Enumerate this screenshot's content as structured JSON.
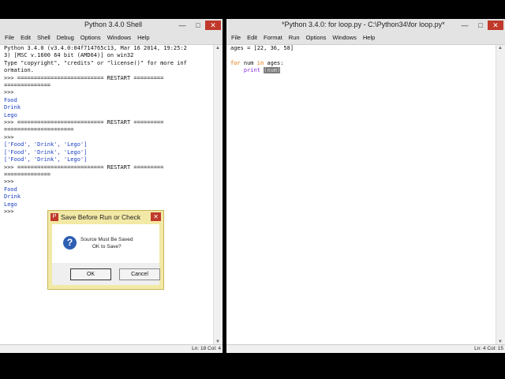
{
  "shell": {
    "title": "Python 3.4.0 Shell",
    "menu": [
      "File",
      "Edit",
      "Shell",
      "Debug",
      "Options",
      "Windows",
      "Help"
    ],
    "lines": [
      "Python 3.4.0 (v3.4.0:04f714765c13, Mar 16 2014, 19:25:2",
      "3) [MSC v.1600 64 bit (AMD64)] on win32",
      "Type \"copyright\", \"credits\" or \"license()\" for more inf",
      "ormation."
    ],
    "restart_label": "RESTART",
    "prompt": ">>>",
    "run1": [
      "Food",
      "Drink",
      "Lego"
    ],
    "run2": [
      "['Food', 'Drink', 'Lego']",
      "['Food', 'Drink', 'Lego']",
      "['Food', 'Drink', 'Lego']"
    ],
    "run3": [
      "Food",
      "Drink",
      "Lego"
    ],
    "status": "Ln: 18 Col: 4"
  },
  "editor": {
    "title": "*Python 3.4.0: for loop.py - C:\\Python34\\for loop.py*",
    "menu": [
      "File",
      "Edit",
      "Format",
      "Run",
      "Options",
      "Windows",
      "Help"
    ],
    "line1": "ages = [22, 36, 58]",
    "line2_kw1": "for",
    "line2_var": " num ",
    "line2_kw2": "in",
    "line2_rest": " ages:",
    "line3_kw": "print",
    "line3_arg": "(num)",
    "status": "Ln: 4 Col: 15"
  },
  "dialog": {
    "title": "Save Before Run or Check",
    "message_line1": "Source Must Be Saved",
    "message_line2": "OK to Save?",
    "ok_label": "OK",
    "cancel_label": "Cancel"
  },
  "window_buttons": {
    "minimize": "—",
    "maximize": "□",
    "close": "✕"
  }
}
